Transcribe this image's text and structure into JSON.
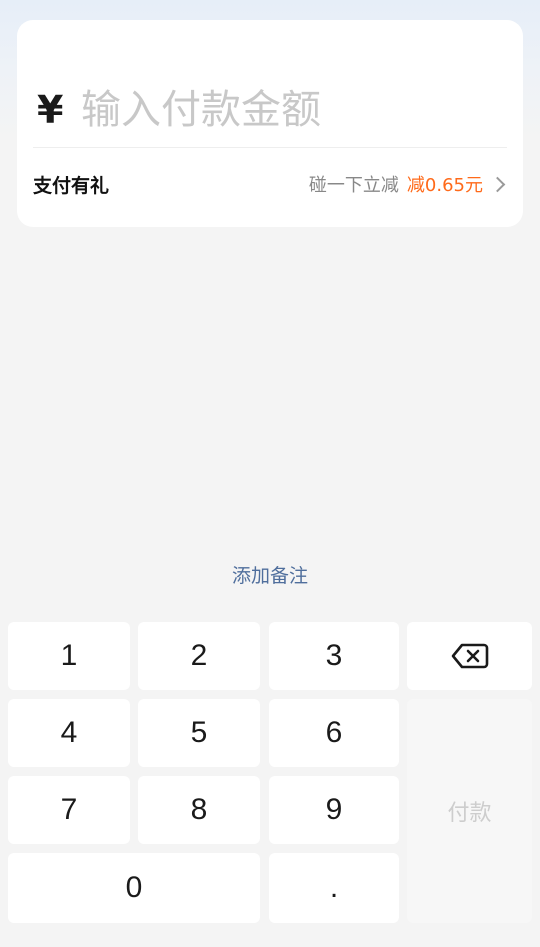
{
  "amount": {
    "currency_symbol": "¥",
    "placeholder": "输入付款金额",
    "value": ""
  },
  "promo": {
    "title": "支付有礼",
    "hint": "碰一下立减",
    "discount": "减0.65元"
  },
  "add_note_label": "添加备注",
  "keypad": {
    "keys": {
      "k1": "1",
      "k2": "2",
      "k3": "3",
      "k4": "4",
      "k5": "5",
      "k6": "6",
      "k7": "7",
      "k8": "8",
      "k9": "9",
      "k0": "0",
      "dot": "."
    },
    "pay_label": "付款",
    "backspace_icon": "backspace-icon"
  },
  "colors": {
    "discount": "#ff6a1a",
    "link": "#4f6e9c",
    "pay_disabled_text": "#cdcdcd"
  }
}
